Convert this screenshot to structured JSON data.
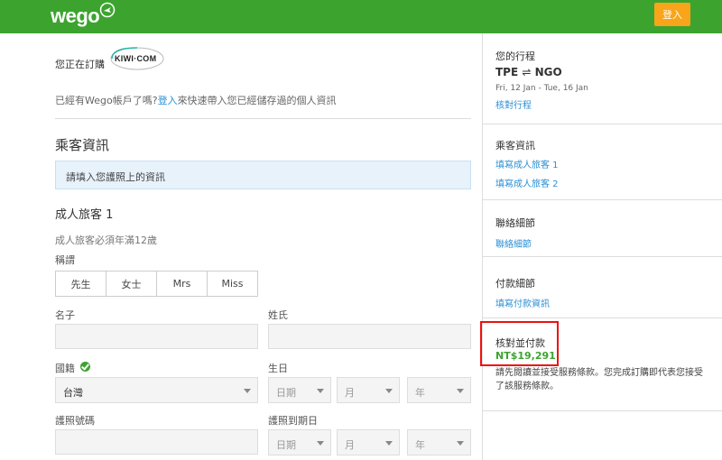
{
  "header": {
    "logo": "wego",
    "login_label": "登入"
  },
  "booking": {
    "booking_with": "您正在訂購",
    "partner_logo_text": "KIWI·COM",
    "account_prompt_pre": "已經有Wego帳戶了嗎?",
    "account_login_link": "登入",
    "account_prompt_post": "來快速帶入您已經儲存過的個人資訊"
  },
  "passenger": {
    "section_title": "乘客資訊",
    "info_notice": "請填入您護照上的資訊",
    "adult_title": "成人旅客 1",
    "adult_note": "成人旅客必須年滿12歲",
    "title_label": "稱謂",
    "title_options": [
      "先生",
      "女士",
      "Mrs",
      "Miss"
    ],
    "first_name_label": "名子",
    "last_name_label": "姓氏",
    "nationality_label": "國籍",
    "nationality_value": "台灣",
    "dob_label": "生日",
    "dob_day_placeholder": "日期",
    "dob_month_placeholder": "月",
    "dob_year_placeholder": "年",
    "passport_label": "護照號碼",
    "passport_expiry_label": "護照到期日",
    "exp_day_placeholder": "日期",
    "exp_month_placeholder": "月",
    "exp_year_placeholder": "年"
  },
  "sidebar": {
    "trip_title": "您的行程",
    "route_from": "TPE",
    "route_to": "NGO",
    "route_dates": "Fri, 12 Jan - Tue, 16 Jan",
    "verify_trip_link": "核對行程",
    "passenger_title": "乘客資訊",
    "passenger_links": [
      "填寫成人旅客 1",
      "填寫成人旅客 2"
    ],
    "contact_title": "聯絡細節",
    "contact_link": "聯絡細節",
    "payment_title": "付款細節",
    "payment_link": "填寫付款資訊",
    "confirm_title": "核對並付款",
    "price": "NT$19,291",
    "terms_text": "請先閱讀並接受服務條款。您完成訂購即代表您接受了該服務條款。"
  },
  "colors": {
    "brand_green": "#3ca42e",
    "login_orange": "#f8a51b",
    "link_blue": "#2b8fd5",
    "highlight_red": "#e11111"
  }
}
